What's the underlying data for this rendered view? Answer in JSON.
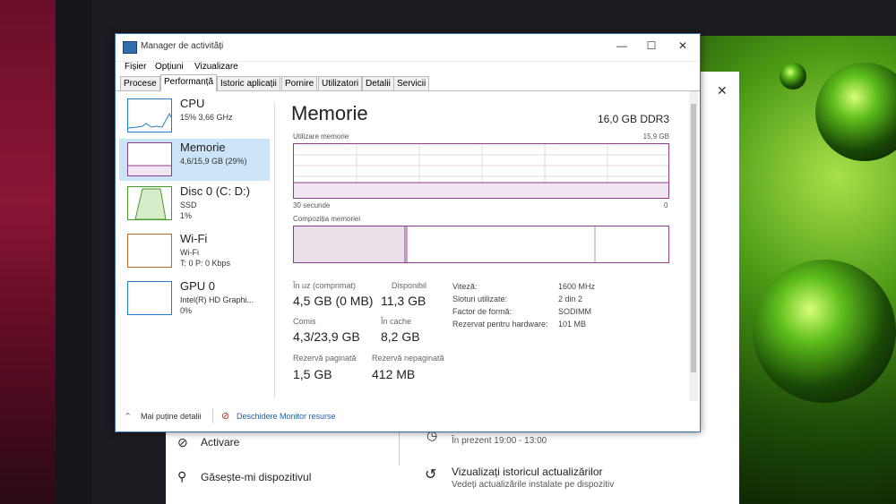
{
  "window": {
    "title": "Manager de activități"
  },
  "menu": [
    "Fișier",
    "Opțiuni",
    "Vizualizare"
  ],
  "tabs": [
    "Procese",
    "Performanță",
    "Istoric aplicații",
    "Pornire",
    "Utilizatori",
    "Detalii",
    "Servicii"
  ],
  "resources": [
    {
      "name": "CPU",
      "line2": "15% 3,66 GHz",
      "line3": ""
    },
    {
      "name": "Memorie",
      "line2": "4,6/15,9 GB (29%)",
      "line3": ""
    },
    {
      "name": "Disc 0 (C: D:)",
      "line2": "SSD",
      "line3": "1%"
    },
    {
      "name": "Wi-Fi",
      "line2": "Wi-Fi",
      "line3": "T: 0 P: 0 Kbps"
    },
    {
      "name": "GPU 0",
      "line2": "Intel(R) HD Graphi...",
      "line3": "0%"
    }
  ],
  "detail": {
    "heading": "Memorie",
    "spec": "16,0 GB DDR3",
    "usage_label": "Utilizare memorie",
    "usage_max": "15,9 GB",
    "time_label": "30 secunde",
    "time_end": "0",
    "composition_label": "Compoziția memoriei",
    "in_use_label": "În uz (comprimat)",
    "in_use_value": "4,5 GB (0 MB)",
    "available_label": "Disponibil",
    "available_value": "11,3 GB",
    "committed_label": "Comis",
    "committed_value": "4,3/23,9 GB",
    "cached_label": "În cache",
    "cached_value": "8,2 GB",
    "paged_label": "Rezervă paginată",
    "paged_value": "1,5 GB",
    "nonpaged_label": "Rezervă nepaginată",
    "nonpaged_value": "412 MB",
    "speed_label": "Viteză:",
    "speed_value": "1600 MHz",
    "slots_label": "Sloturi utilizate:",
    "slots_value": "2 din 2",
    "form_label": "Factor de formă:",
    "form_value": "SODIMM",
    "reserved_label": "Rezervat pentru hardware:",
    "reserved_value": "101 MB",
    "usage_fraction": 0.29
  },
  "footer": {
    "fewer": "Mai puține detalii",
    "monitor": "Deschidere Monitor resurse"
  },
  "settings": {
    "activation": "Activare",
    "find_device": "Găsește-mi dispozitivul",
    "time_range": "În prezent 19:00 - 13:00",
    "history_title": "Vizualizați istoricul actualizărilor",
    "history_sub": "Vedeți actualizările instalate pe dispozitiv"
  },
  "colors": {
    "memory": "#8b3f8b",
    "cpu": "#1e7fc7",
    "disk": "#4a9a2a",
    "wifi": "#b9652c",
    "gpu": "#1e7fc7"
  }
}
